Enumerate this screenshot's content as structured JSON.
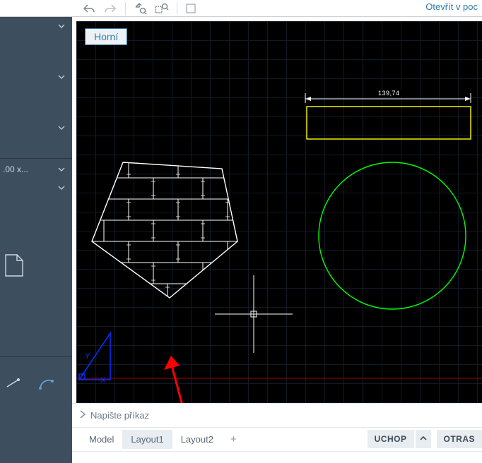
{
  "topbar": {
    "right_text": "Otevřít v poc"
  },
  "view": {
    "label": "Horní"
  },
  "sidebar": {
    "zoom_text": ".00 x..."
  },
  "dimension": {
    "value": "139,74"
  },
  "command": {
    "placeholder": "Napište příkaz"
  },
  "tabs": {
    "model": "Model",
    "layout1": "Layout1",
    "layout2": "Layout2",
    "add": "+"
  },
  "status": {
    "snap": "UCHOP",
    "osnap": "OTRAS"
  },
  "chart_data": {
    "type": "diagram",
    "note": "CAD drawing canvas (not a data chart)",
    "objects": [
      {
        "kind": "dimension",
        "value": 139.74,
        "color": "#ffffff"
      },
      {
        "kind": "rectangle",
        "approx_width": 230,
        "approx_height": 46,
        "color": "#ffff00"
      },
      {
        "kind": "circle",
        "approx_radius": 104,
        "color": "#00ff00"
      },
      {
        "kind": "polygon",
        "sides": 5,
        "hatch": "brick",
        "color": "#ffffff"
      },
      {
        "kind": "ucs-icon",
        "axes": [
          "X",
          "Y"
        ],
        "color": "#0000ff"
      },
      {
        "kind": "crosshair"
      }
    ]
  }
}
